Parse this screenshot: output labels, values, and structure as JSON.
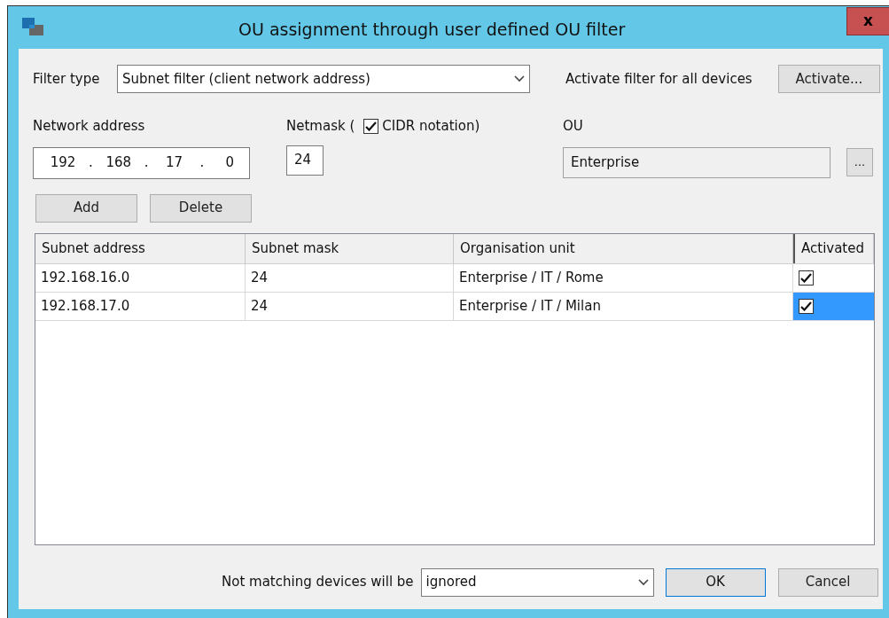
{
  "window": {
    "title": "OU assignment through user defined OU filter",
    "close": "x"
  },
  "filter_type": {
    "label": "Filter type",
    "value": "Subnet filter (client network address)"
  },
  "activate": {
    "label": "Activate filter for all devices",
    "button": "Activate..."
  },
  "network_address": {
    "label": "Network address",
    "octets": [
      "192",
      "168",
      "17",
      "0"
    ],
    "separator": "."
  },
  "netmask": {
    "label": "Netmask (",
    "value": "24",
    "cidr": {
      "label": "CIDR notation)",
      "checked": true
    }
  },
  "ou": {
    "label": "OU",
    "value": "Enterprise",
    "browse": "..."
  },
  "buttons": [
    "Add",
    "Delete"
  ],
  "table": {
    "columns": [
      "Subnet address",
      "Subnet mask",
      "Organisation unit",
      "Activated"
    ],
    "rows": [
      {
        "cells": [
          "192.168.16.0",
          "24",
          "Enterprise / IT / Rome"
        ],
        "activated": true,
        "selected": false
      },
      {
        "cells": [
          "192.168.17.0",
          "24",
          "Enterprise / IT / Milan"
        ],
        "activated": true,
        "selected": true
      }
    ]
  },
  "footer": {
    "label": "Not matching devices will be",
    "value": "ignored",
    "ok": "OK",
    "cancel": "Cancel"
  }
}
